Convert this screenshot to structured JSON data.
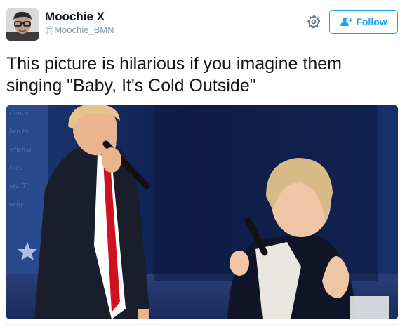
{
  "tweet": {
    "author": {
      "display_name": "Moochie X",
      "handle": "@Moochie_BMN"
    },
    "actions": {
      "follow_label": "Follow",
      "settings_icon": "gear-icon",
      "follow_icon": "add-user-icon"
    },
    "text_lines": [
      "This picture is hilarious if you imagine them",
      "singing \"Baby, It's Cold Outside\""
    ],
    "media": {
      "type": "photo"
    }
  },
  "colors": {
    "accent": "#1da1f2",
    "text": "#14171a",
    "muted": "#8899a6"
  }
}
